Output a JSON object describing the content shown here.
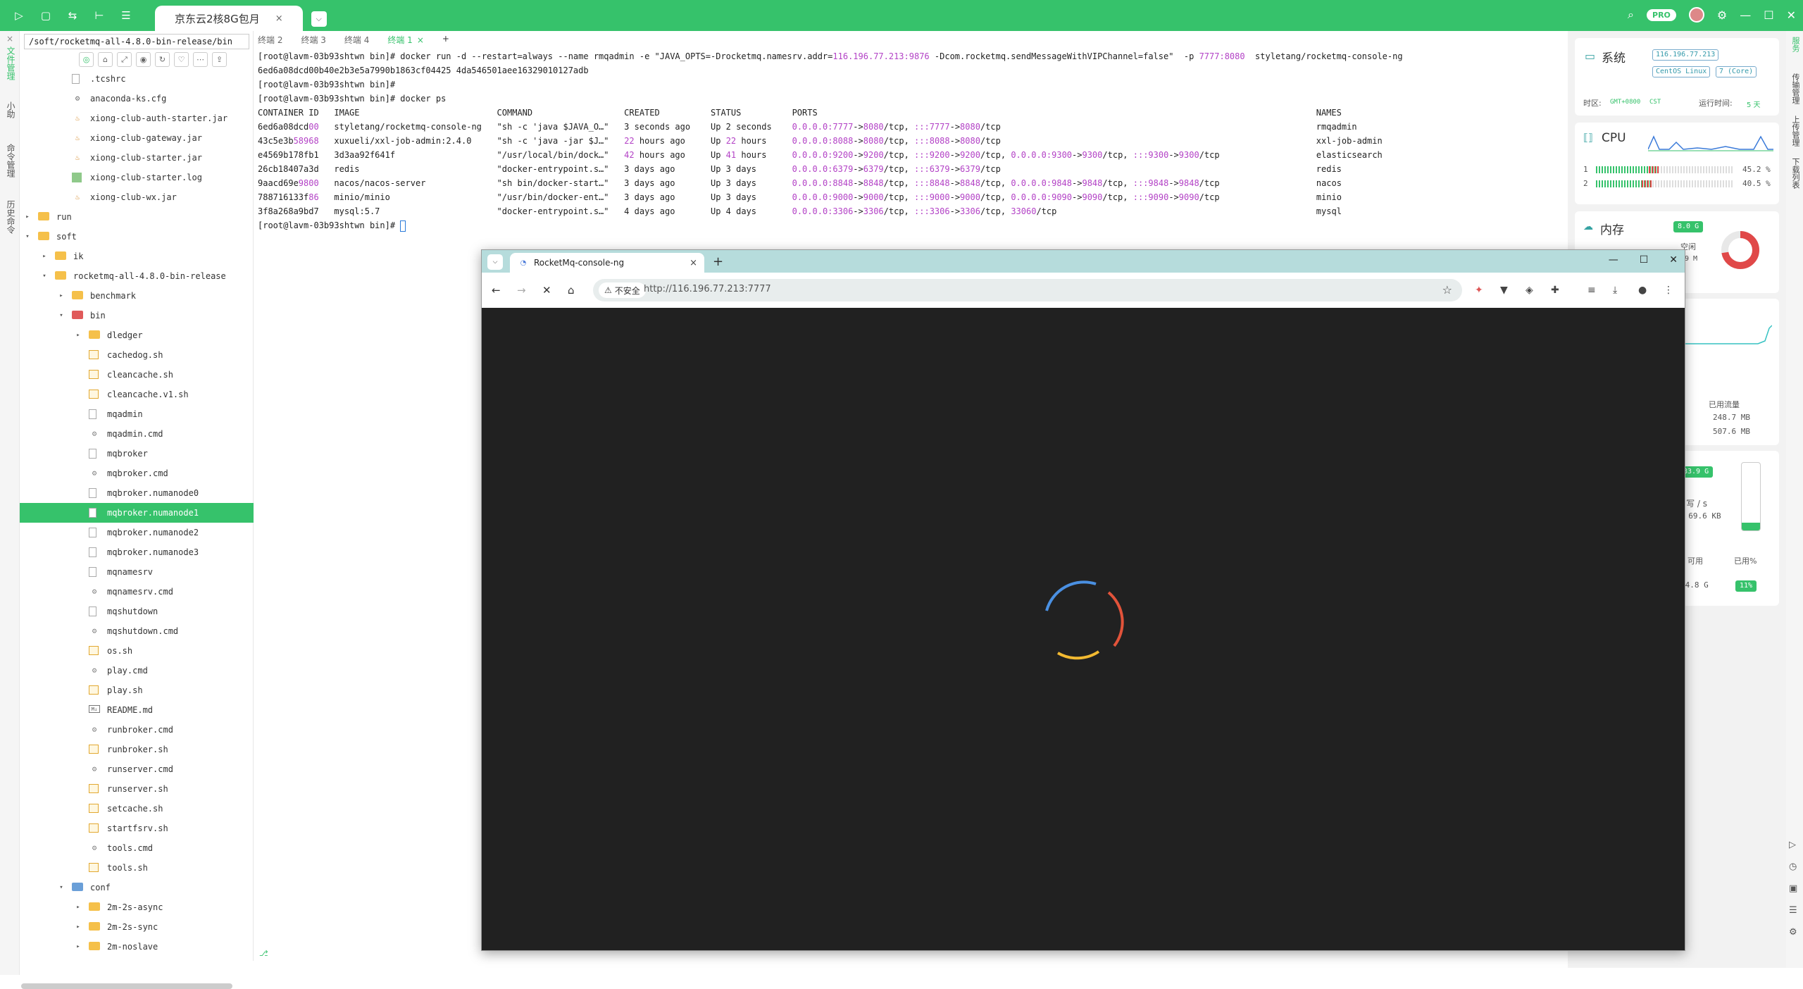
{
  "app": {
    "session_tab": "京东云2核8G包月",
    "session_tab_close": "×",
    "badge": "PRO"
  },
  "left_strip": [
    "文件管理",
    "小助",
    "命令管理",
    "历史命令"
  ],
  "file_panel": {
    "path": "/soft/rocketmq-all-4.8.0-bin-release/bin",
    "tree": [
      {
        "label": ".tcshrc",
        "icon": "file",
        "depth": 2
      },
      {
        "label": "anaconda-ks.cfg",
        "icon": "gear",
        "depth": 2
      },
      {
        "label": "xiong-club-auth-starter.jar",
        "icon": "jar",
        "depth": 2
      },
      {
        "label": "xiong-club-gateway.jar",
        "icon": "jar",
        "depth": 2
      },
      {
        "label": "xiong-club-starter.jar",
        "icon": "jar",
        "depth": 2
      },
      {
        "label": "xiong-club-starter.log",
        "icon": "log",
        "depth": 2
      },
      {
        "label": "xiong-club-wx.jar",
        "icon": "jar",
        "depth": 2
      },
      {
        "label": "run",
        "icon": "folder",
        "depth": 0,
        "twisty": "▸"
      },
      {
        "label": "soft",
        "icon": "folder",
        "depth": 0,
        "twisty": "▾"
      },
      {
        "label": "ik",
        "icon": "folder",
        "depth": 1,
        "twisty": "▸"
      },
      {
        "label": "rocketmq-all-4.8.0-bin-release",
        "icon": "folder",
        "depth": 1,
        "twisty": "▾"
      },
      {
        "label": "benchmark",
        "icon": "folder",
        "depth": 2,
        "twisty": "▸"
      },
      {
        "label": "bin",
        "icon": "folder-r",
        "depth": 2,
        "twisty": "▾"
      },
      {
        "label": "dledger",
        "icon": "folder",
        "depth": 3,
        "twisty": "▸"
      },
      {
        "label": "cachedog.sh",
        "icon": "sh",
        "depth": 3
      },
      {
        "label": "cleancache.sh",
        "icon": "sh",
        "depth": 3
      },
      {
        "label": "cleancache.v1.sh",
        "icon": "sh",
        "depth": 3
      },
      {
        "label": "mqadmin",
        "icon": "file",
        "depth": 3
      },
      {
        "label": "mqadmin.cmd",
        "icon": "cmd",
        "depth": 3
      },
      {
        "label": "mqbroker",
        "icon": "file",
        "depth": 3
      },
      {
        "label": "mqbroker.cmd",
        "icon": "cmd",
        "depth": 3
      },
      {
        "label": "mqbroker.numanode0",
        "icon": "file",
        "depth": 3
      },
      {
        "label": "mqbroker.numanode1",
        "icon": "file",
        "depth": 3,
        "selected": true
      },
      {
        "label": "mqbroker.numanode2",
        "icon": "file",
        "depth": 3
      },
      {
        "label": "mqbroker.numanode3",
        "icon": "file",
        "depth": 3
      },
      {
        "label": "mqnamesrv",
        "icon": "file",
        "depth": 3
      },
      {
        "label": "mqnamesrv.cmd",
        "icon": "cmd",
        "depth": 3
      },
      {
        "label": "mqshutdown",
        "icon": "file",
        "depth": 3
      },
      {
        "label": "mqshutdown.cmd",
        "icon": "cmd",
        "depth": 3
      },
      {
        "label": "os.sh",
        "icon": "sh",
        "depth": 3
      },
      {
        "label": "play.cmd",
        "icon": "cmd",
        "depth": 3
      },
      {
        "label": "play.sh",
        "icon": "sh",
        "depth": 3
      },
      {
        "label": "README.md",
        "icon": "md",
        "depth": 3
      },
      {
        "label": "runbroker.cmd",
        "icon": "cmd",
        "depth": 3
      },
      {
        "label": "runbroker.sh",
        "icon": "sh",
        "depth": 3
      },
      {
        "label": "runserver.cmd",
        "icon": "cmd",
        "depth": 3
      },
      {
        "label": "runserver.sh",
        "icon": "sh",
        "depth": 3
      },
      {
        "label": "setcache.sh",
        "icon": "sh",
        "depth": 3
      },
      {
        "label": "startfsrv.sh",
        "icon": "sh",
        "depth": 3
      },
      {
        "label": "tools.cmd",
        "icon": "cmd",
        "depth": 3
      },
      {
        "label": "tools.sh",
        "icon": "sh",
        "depth": 3
      },
      {
        "label": "conf",
        "icon": "folder-b",
        "depth": 2,
        "twisty": "▾"
      },
      {
        "label": "2m-2s-async",
        "icon": "folder",
        "depth": 3,
        "twisty": "▸"
      },
      {
        "label": "2m-2s-sync",
        "icon": "folder",
        "depth": 3,
        "twisty": "▸"
      },
      {
        "label": "2m-noslave",
        "icon": "folder",
        "depth": 3,
        "twisty": "▸"
      }
    ]
  },
  "terminal": {
    "tabs": [
      {
        "label": "终端 2",
        "active": false
      },
      {
        "label": "终端 3",
        "active": false
      },
      {
        "label": "终端 4",
        "active": false
      },
      {
        "label": "终端 1",
        "active": true
      }
    ],
    "tab_close": "×",
    "new_tab": "+",
    "lines": [
      "[root@lavm-03b93shtwn bin]# docker run -d --restart=always --name rmqadmin -e \"JAVA_OPTS=-Drocketmq.namesrv.addr=116.196.77.213:9876 -Dcom.rocketmq.sendMessageWithVIPChannel=false\"  -p 7777:8080  styletang/rocketmq-console-ng",
      "6ed6a08dcd00b40e2b3e5a7990b1863cf04425 4da546501aee16329010127adb",
      "[root@lavm-03b93shtwn bin]#",
      "[root@lavm-03b93shtwn bin]# docker ps",
      "CONTAINER ID   IMAGE                           COMMAND                  CREATED          STATUS          PORTS                                                                                                  NAMES",
      "6ed6a08dcd00   styletang/rocketmq-console-ng   \"sh -c 'java $JAVA_O…\"   3 seconds ago    Up 2 seconds    0.0.0.0:7777->8080/tcp, :::7777->8080/tcp                                                              rmqadmin",
      "43c5e3b58968   xuxueli/xxl-job-admin:2.4.0     \"sh -c 'java -jar $J…\"   22 hours ago     Up 22 hours     0.0.0.0:8088->8080/tcp, :::8088->8080/tcp                                                              xxl-job-admin",
      "e4569b178fb1   3d3aa92f641f                    \"/usr/local/bin/dock…\"   42 hours ago     Up 41 hours     0.0.0.0:9200->9200/tcp, :::9200->9200/tcp, 0.0.0.0:9300->9300/tcp, :::9300->9300/tcp                   elasticsearch",
      "26cb18407a3d   redis                           \"docker-entrypoint.s…\"   3 days ago       Up 3 days       0.0.0.0:6379->6379/tcp, :::6379->6379/tcp                                                              redis",
      "9aacd69e9800   nacos/nacos-server              \"sh bin/docker-start…\"   3 days ago       Up 3 days       0.0.0.0:8848->8848/tcp, :::8848->8848/tcp, 0.0.0.0:9848->9848/tcp, :::9848->9848/tcp                   nacos",
      "788716133f86   minio/minio                     \"/usr/bin/docker-ent…\"   3 days ago       Up 3 days       0.0.0.0:9000->9000/tcp, :::9000->9000/tcp, 0.0.0.0:9090->9090/tcp, :::9090->9090/tcp                   minio",
      "3f8a268a9bd7   mysql:5.7                       \"docker-entrypoint.s…\"   4 days ago       Up 4 days       0.0.0.0:3306->3306/tcp, :::3306->3306/tcp, 33060/tcp                                                   mysql",
      "[root@lavm-03b93shtwn bin]# "
    ]
  },
  "monitor": {
    "system": {
      "title": "系统",
      "ip": "116.196.77.213",
      "os": "CentOS Linux",
      "cores": "7 (Core)",
      "tz_label": "时区:",
      "tz": "GMT+0800",
      "tz_abbr": "CST",
      "uptime_label": "运行时间:",
      "uptime": "5 天"
    },
    "cpu": {
      "title": "CPU",
      "cores": [
        {
          "id": "1",
          "percent": "45.2 %",
          "level": 0.452
        },
        {
          "id": "2",
          "percent": "40.5 %",
          "level": 0.405
        }
      ]
    },
    "memory": {
      "title": "内存",
      "total": "8.0 G",
      "free_label": "空闲",
      "free": ".9 M"
    },
    "network": {
      "used_label": "已用流量",
      "frag_s1": "s",
      "frag_s2": "s",
      "used_up": "248.7 MB",
      "used_down": "507.6 MB"
    },
    "disk": {
      "size": "83.9 G",
      "rw_label": "s 写 / s",
      "rw": "3 69.6 KB",
      "avail_label": "可用",
      "used_pct_label": "已用%",
      "avail": "74.8 G",
      "used_pct": "11%"
    }
  },
  "right_strip": [
    "服务",
    "传输管理",
    "上传管理",
    "下载列表"
  ],
  "browser": {
    "tab_title": "RocketMq-console-ng",
    "tab_close": "×",
    "new_tab": "+",
    "insecure": "不安全",
    "url": "http://116.196.77.213:7777"
  }
}
